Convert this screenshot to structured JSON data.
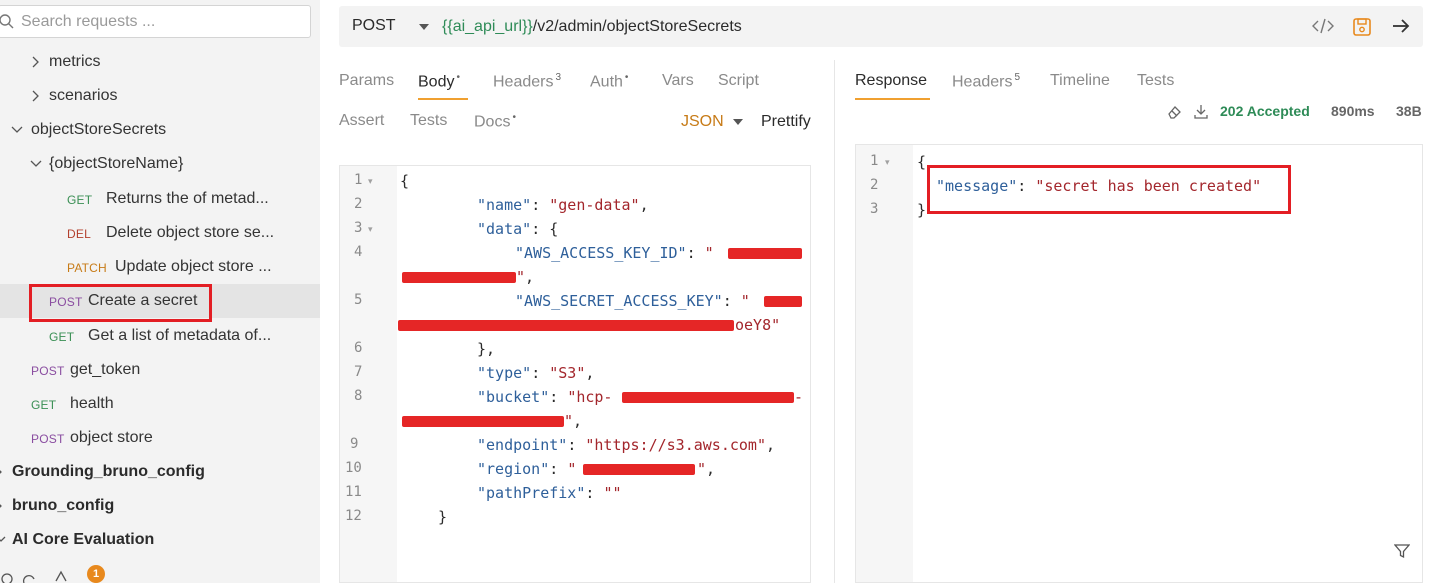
{
  "sidebar": {
    "search_placeholder": "Search requests ...",
    "items": [
      {
        "label": "metrics"
      },
      {
        "label": "scenarios"
      },
      {
        "label": "objectStoreSecrets"
      },
      {
        "label": "{objectStoreName}"
      },
      {
        "method": "GET",
        "label": "Returns the of metad..."
      },
      {
        "method": "DEL",
        "label": "Delete object store se..."
      },
      {
        "method": "PATCH",
        "label": "Update object store ..."
      },
      {
        "method": "POST",
        "label": "Create a secret"
      },
      {
        "method": "GET",
        "label": "Get a list of metadata of..."
      },
      {
        "method": "POST",
        "label": "get_token"
      },
      {
        "method": "GET",
        "label": "health"
      },
      {
        "method": "POST",
        "label": "object store"
      }
    ],
    "collections": [
      {
        "label": "Grounding_bruno_config"
      },
      {
        "label": "bruno_config"
      },
      {
        "label": "AI Core Evaluation"
      }
    ],
    "notification_count": "1"
  },
  "request": {
    "method": "POST",
    "url_variable": "{{ai_api_url}}",
    "url_path": "/v2/admin/objectStoreSecrets",
    "tabs_row1": [
      {
        "label": "Params",
        "sup": ""
      },
      {
        "label": "Body",
        "sup": "•"
      },
      {
        "label": "Headers",
        "sup": "3"
      },
      {
        "label": "Auth",
        "sup": "•"
      },
      {
        "label": "Vars",
        "sup": ""
      },
      {
        "label": "Script",
        "sup": ""
      }
    ],
    "tabs_row2": [
      {
        "label": "Assert",
        "sup": ""
      },
      {
        "label": "Tests",
        "sup": ""
      },
      {
        "label": "Docs",
        "sup": "•"
      }
    ],
    "body_mode": "JSON",
    "prettify_label": "Prettify",
    "line_numbers": [
      "1",
      "2",
      "3",
      "4",
      "5",
      "6",
      "7",
      "8",
      "9",
      "10",
      "11",
      "12"
    ],
    "body": {
      "name_key": "\"name\"",
      "name_val": "\"gen-data\"",
      "data_key": "\"data\"",
      "access_key_key": "\"AWS_ACCESS_KEY_ID\"",
      "secret_key_key": "\"AWS_SECRET_ACCESS_KEY\"",
      "secret_key_tail": "oeY8\"",
      "type_key": "\"type\"",
      "type_val": "\"S3\"",
      "bucket_key": "\"bucket\"",
      "bucket_val_start": "\"hcp-",
      "endpoint_key": "\"endpoint\"",
      "endpoint_val": "\"https://s3.aws.com\"",
      "region_key": "\"region\"",
      "pathprefix_key": "\"pathPrefix\"",
      "pathprefix_val": "\"\""
    }
  },
  "response": {
    "tabs": [
      {
        "label": "Response",
        "sup": ""
      },
      {
        "label": "Headers",
        "sup": "5"
      },
      {
        "label": "Timeline",
        "sup": ""
      },
      {
        "label": "Tests",
        "sup": ""
      }
    ],
    "status": "202 Accepted",
    "time": "890ms",
    "size": "38B",
    "line_numbers": [
      "1",
      "2",
      "3"
    ],
    "message_key": "\"message\"",
    "message_val": "\"secret has been created\""
  },
  "colors": {
    "accent": "#f0a030",
    "highlight_box": "#e31e24",
    "get": "#3a8f54",
    "post": "#8a4da0",
    "del": "#b3402d",
    "patch": "#c77b17"
  }
}
